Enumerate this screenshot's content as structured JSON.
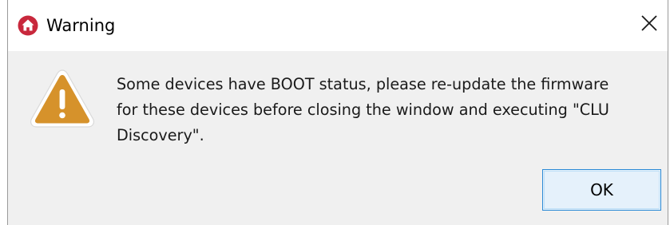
{
  "window": {
    "title": "Warning",
    "icon": "home-icon",
    "close_icon": "close-icon"
  },
  "dialog": {
    "icon": "warning-icon",
    "message": "Some devices have BOOT status, please re-update the firmware\nfor these devices before closing the window and executing \"CLU\nDiscovery\".",
    "ok_label": "OK"
  },
  "colors": {
    "app_icon": "#c8283c",
    "warning_icon": "#d6922b",
    "button_border": "#2b8ad6",
    "button_fill": "#e5f1fb",
    "content_bg": "#f0f0f0"
  }
}
